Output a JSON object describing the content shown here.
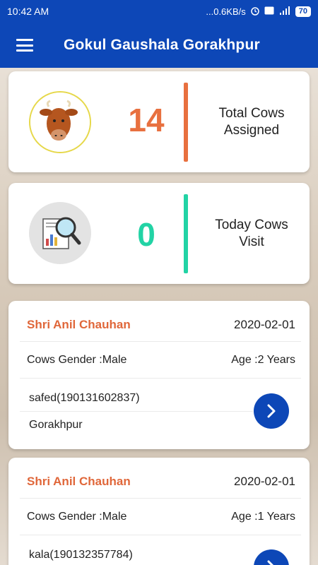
{
  "status_bar": {
    "time": "10:42 AM",
    "net_speed": "...0.6KB/s",
    "battery": "70",
    "icons": [
      "alarm-icon",
      "volte-icon",
      "signal-4g-icon",
      "battery-icon"
    ]
  },
  "app_bar": {
    "title": "Gokul Gaushala Gorakhpur",
    "menu_icon": "hamburger-menu-icon"
  },
  "stats": [
    {
      "count": "14",
      "label_line1": "Total Cows",
      "label_line2": "Assigned",
      "color": "#e8703f",
      "icon": "cow-avatar-icon"
    },
    {
      "count": "0",
      "label_line1": "Today Cows",
      "label_line2": "Visit",
      "color": "#22d3a5",
      "icon": "report-search-icon"
    }
  ],
  "records": [
    {
      "owner": "Shri Anil Chauhan",
      "date": "2020-02-01",
      "gender": "Cows Gender :Male",
      "age": "Age :2 Years",
      "tag": "safed(190131602837)",
      "location": "Gorakhpur"
    },
    {
      "owner": "Shri Anil Chauhan",
      "date": "2020-02-01",
      "gender": "Cows Gender :Male",
      "age": "Age :1 Years",
      "tag": "kala(190132357784)",
      "location": ""
    }
  ],
  "colors": {
    "primary": "#0d47b7",
    "accent_orange": "#e0673a",
    "accent_green": "#22d3a5"
  }
}
